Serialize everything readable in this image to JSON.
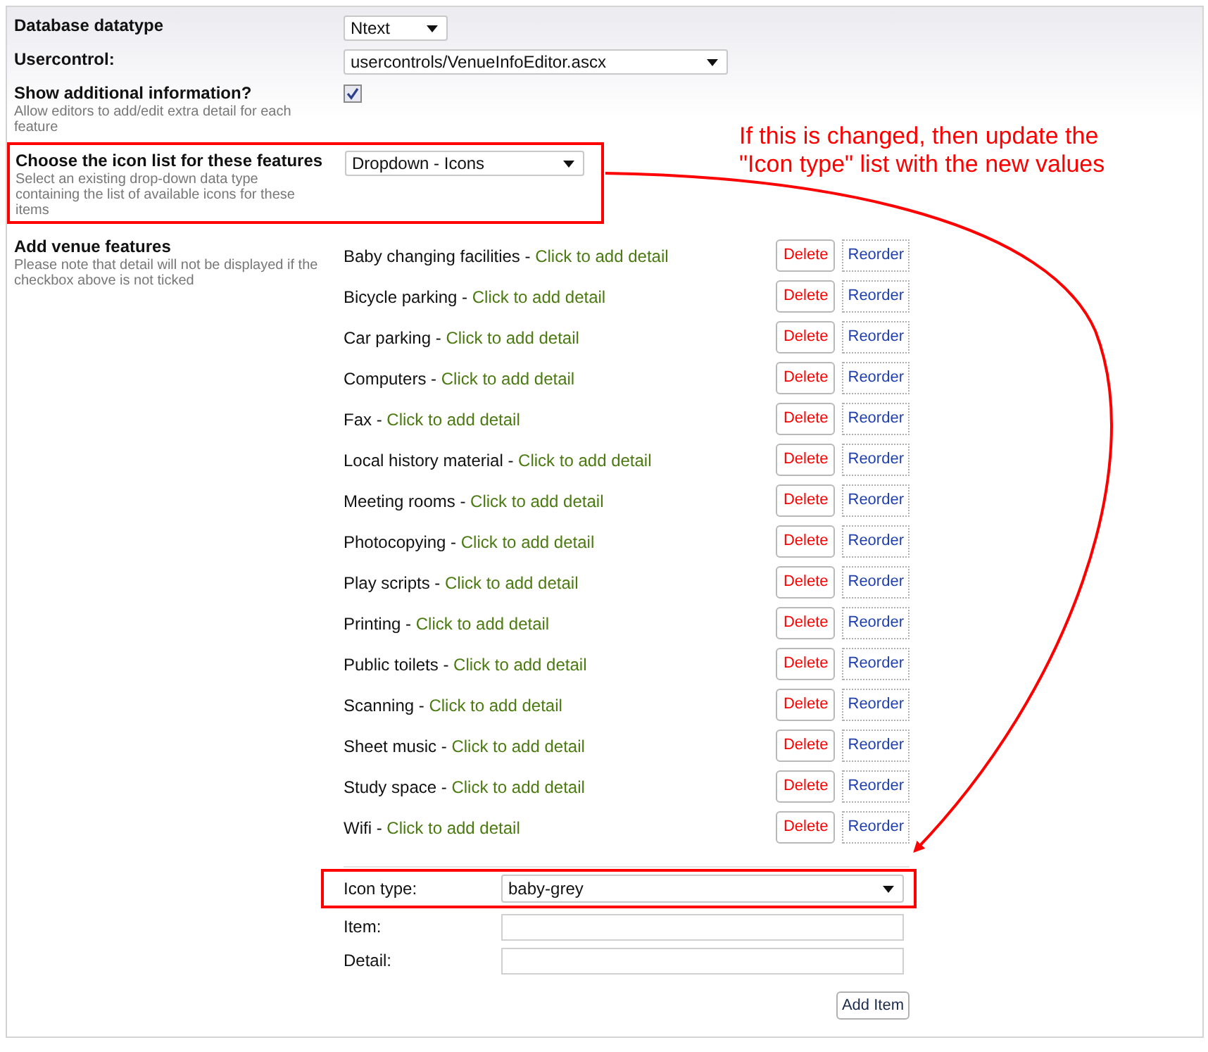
{
  "settings": [
    {
      "kind": "select",
      "label": "Database datatype",
      "value": "Ntext",
      "highlighted": false
    },
    {
      "kind": "select",
      "label": "Usercontrol:",
      "value": "usercontrols/VenueInfoEditor.ascx",
      "highlighted": false
    },
    {
      "kind": "checkbox",
      "label": "Show additional information?",
      "description": "Allow editors to add/edit extra detail for each feature",
      "checked": true,
      "highlighted": false
    },
    {
      "kind": "select",
      "label": "Choose the icon list for these features",
      "description": "Select an existing drop-down data type containing the list of available icons for these items",
      "value": "Dropdown - Icons",
      "highlighted": true
    }
  ],
  "features": {
    "label": "Add venue features",
    "description": "Please note that detail will not be displayed if the checkbox above is not ticked",
    "separator": "-",
    "items": [
      {
        "name": "Baby changing facilities",
        "link": "Click to add detail",
        "delete": "Delete",
        "reorder": "Reorder"
      },
      {
        "name": "Bicycle parking",
        "link": "Click to add detail",
        "delete": "Delete",
        "reorder": "Reorder"
      },
      {
        "name": "Car parking",
        "link": "Click to add detail",
        "delete": "Delete",
        "reorder": "Reorder"
      },
      {
        "name": "Computers",
        "link": "Click to add detail",
        "delete": "Delete",
        "reorder": "Reorder"
      },
      {
        "name": "Fax",
        "link": "Click to add detail",
        "delete": "Delete",
        "reorder": "Reorder"
      },
      {
        "name": "Local history material",
        "link": "Click to add detail",
        "delete": "Delete",
        "reorder": "Reorder"
      },
      {
        "name": "Meeting rooms",
        "link": "Click to add detail",
        "delete": "Delete",
        "reorder": "Reorder"
      },
      {
        "name": "Photocopying",
        "link": "Click to add detail",
        "delete": "Delete",
        "reorder": "Reorder"
      },
      {
        "name": "Play scripts",
        "link": "Click to add detail",
        "delete": "Delete",
        "reorder": "Reorder"
      },
      {
        "name": "Printing",
        "link": "Click to add detail",
        "delete": "Delete",
        "reorder": "Reorder"
      },
      {
        "name": "Public toilets",
        "link": "Click to add detail",
        "delete": "Delete",
        "reorder": "Reorder"
      },
      {
        "name": "Scanning",
        "link": "Click to add detail",
        "delete": "Delete",
        "reorder": "Reorder"
      },
      {
        "name": "Sheet music",
        "link": "Click to add detail",
        "delete": "Delete",
        "reorder": "Reorder"
      },
      {
        "name": "Study space",
        "link": "Click to add detail",
        "delete": "Delete",
        "reorder": "Reorder"
      },
      {
        "name": "Wifi",
        "link": "Click to add detail",
        "delete": "Delete",
        "reorder": "Reorder"
      }
    ]
  },
  "add_form": {
    "fields": [
      {
        "kind": "select",
        "label": "Icon type:",
        "value": "baby-grey",
        "highlighted": true
      },
      {
        "kind": "text",
        "label": "Item:",
        "highlighted": false
      },
      {
        "kind": "text",
        "label": "Detail:",
        "highlighted": false
      }
    ],
    "button": "Add Item"
  },
  "annotation": {
    "lines": [
      "If this is changed, then update the",
      "\"Icon type\" list with the new values"
    ]
  }
}
